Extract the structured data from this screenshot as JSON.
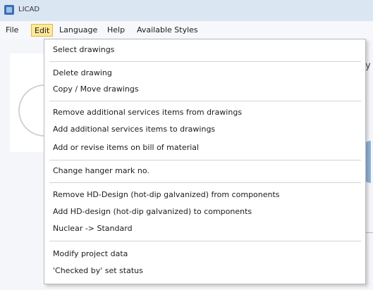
{
  "window": {
    "title": "LICAD"
  },
  "menubar": {
    "items": [
      {
        "label": "File"
      },
      {
        "label": "Edit"
      },
      {
        "label": "Language"
      },
      {
        "label": "Help"
      },
      {
        "label": "Available Styles"
      }
    ]
  },
  "edit_menu": {
    "items": [
      {
        "label": "Select drawings"
      },
      {
        "label": "Delete drawing"
      },
      {
        "label": "Copy / Move drawings"
      },
      {
        "label": "Remove additional services items from drawings"
      },
      {
        "label": "Add additional services items to drawings"
      },
      {
        "label": "Add or revise items on bill of material"
      },
      {
        "label": "Change hanger mark no."
      },
      {
        "label": "Remove HD-Design (hot-dip galvanized) from components"
      },
      {
        "label": "Add HD-design (hot-dip galvanized) to components"
      },
      {
        "label": "Nuclear -> Standard"
      },
      {
        "label": "Modify project data"
      },
      {
        "label": "'Checked by' set status"
      }
    ]
  },
  "background": {
    "partial_text": "y"
  },
  "colors": {
    "active_menu_bg": "#fde99a",
    "active_menu_border": "#e3b648",
    "titlebar_bg": "#dbe6f3"
  }
}
